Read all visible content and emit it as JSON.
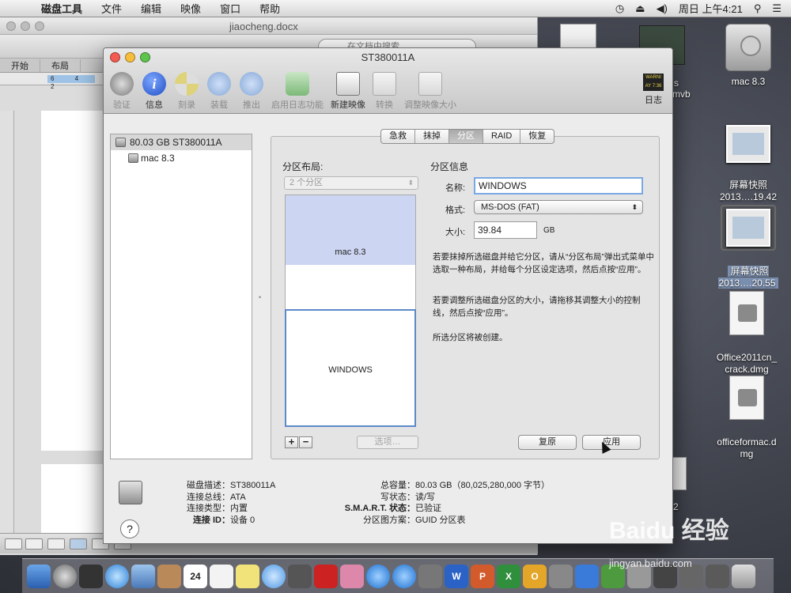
{
  "menubar": {
    "app_name": "磁盘工具",
    "items": [
      "文件",
      "编辑",
      "映像",
      "窗口",
      "帮助"
    ],
    "clock": "周日 上午4:21"
  },
  "word": {
    "doc_title": "jiaocheng.docx",
    "search_placeholder": "在文档中搜索",
    "ribbon": [
      "开始",
      "布局"
    ],
    "ruler": "6 4 2"
  },
  "desktop": {
    "icons": [
      {
        "label": "mac 8.3"
      },
      {
        "label": "屏幕快照\n2013….19.42"
      },
      {
        "label": "屏幕快照\n2013….20.55"
      },
      {
        "label": "Office2011cn_\ncrack.dmg"
      },
      {
        "label": "officeformac.d\nmg"
      }
    ],
    "partial_labels": [
      "s",
      "mvb",
      "2"
    ]
  },
  "window": {
    "title": "ST380011A",
    "toolbar": [
      {
        "label": "验证",
        "enabled": false
      },
      {
        "label": "信息",
        "enabled": true
      },
      {
        "label": "刻录",
        "enabled": false
      },
      {
        "label": "装载",
        "enabled": false
      },
      {
        "label": "推出",
        "enabled": false
      },
      {
        "label": "启用日志功能",
        "enabled": false
      },
      {
        "label": "新建映像",
        "enabled": true
      },
      {
        "label": "转换",
        "enabled": false
      },
      {
        "label": "调整映像大小",
        "enabled": false
      }
    ],
    "log_button": {
      "label": "日志",
      "icon_text": "WARNI\nAY 7:36"
    },
    "sidebar": [
      {
        "label": "80.03 GB ST380011A",
        "selected": true
      },
      {
        "label": "mac 8.3",
        "selected": false
      }
    ],
    "tabs": [
      {
        "label": "急救"
      },
      {
        "label": "抹掉"
      },
      {
        "label": "分区",
        "active": true
      },
      {
        "label": "RAID"
      },
      {
        "label": "恢复"
      }
    ],
    "partition": {
      "layout_label": "分区布局:",
      "layout_select": "2 个分区",
      "segments": [
        "mac 8.3",
        "WINDOWS"
      ],
      "add": "+",
      "remove": "−",
      "options": "选项…",
      "info_label": "分区信息",
      "name_label": "名称:",
      "name_value": "WINDOWS",
      "format_label": "格式:",
      "format_value": "MS-DOS (FAT)",
      "size_label": "大小:",
      "size_value": "39.84",
      "size_unit": "GB",
      "info_text_1": "若要抹掉所选磁盘并给它分区，请从“分区布局”弹出式菜单中选取一种布局，并给每个分区设定选项，然后点按“应用”。",
      "info_text_2": "若要调整所选磁盘分区的大小，请拖移其调整大小的控制线，然后点按“应用”。",
      "info_text_3": "所选分区将被创建。",
      "revert": "复原",
      "apply": "应用"
    },
    "details_left": [
      {
        "k": "磁盘描述：",
        "v": "ST380011A"
      },
      {
        "k": "连接总线：",
        "v": "ATA"
      },
      {
        "k": "连接类型：",
        "v": "内置"
      },
      {
        "k": "连接 ID：",
        "v": "设备 0"
      }
    ],
    "details_right": [
      {
        "k": "总容量：",
        "v": "80.03 GB（80,025,280,000 字节）"
      },
      {
        "k": "写状态：",
        "v": "读/写"
      },
      {
        "k": "S.M.A.R.T. 状态：",
        "v": "已验证"
      },
      {
        "k": "分区图方案：",
        "v": "GUID 分区表"
      }
    ],
    "help": "?"
  },
  "dock": {
    "calendar_day": "24",
    "letters": [
      "W",
      "P",
      "X",
      "O"
    ]
  },
  "watermark": {
    "brand": "Baidu 经验",
    "url": "jingyan.baidu.com"
  },
  "colors": {
    "partition_used": "#ccd5f1",
    "selection_border": "#5c8ac9",
    "focus_ring": "#7aa8e4"
  }
}
